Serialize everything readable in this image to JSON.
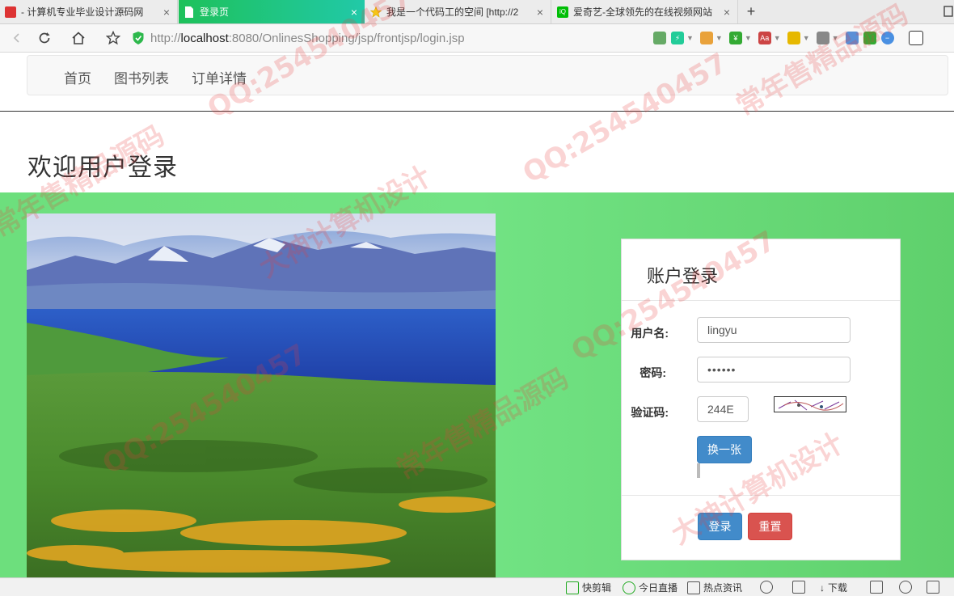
{
  "browser": {
    "tabs": [
      {
        "label": "- 计算机专业毕业设计源码网",
        "close": "×"
      },
      {
        "label": "登录页",
        "close": "×"
      },
      {
        "label": "我是一个代码工的空间 [http://2",
        "close": "×"
      },
      {
        "label": "爱奇艺-全球领先的在线视频网站",
        "close": "×"
      }
    ],
    "new_tab": "+",
    "url_prefix": "http://",
    "url_host": "localhost",
    "url_rest": ":8080/OnlinesShopping/jsp/frontjsp/login.jsp"
  },
  "nav": {
    "items": [
      "首页",
      "图书列表",
      "订单详情"
    ]
  },
  "page": {
    "heading": "欢迎用户登录"
  },
  "login": {
    "title": "账户登录",
    "username_label": "用户名:",
    "username_value": "lingyu",
    "password_label": "密码:",
    "password_value": "••••••",
    "captcha_label": "验证码:",
    "captcha_value": "244E",
    "refresh_label": "换一张",
    "submit_label": "登录",
    "reset_label": "重置"
  },
  "statusbar": {
    "items": [
      "快剪辑",
      "今日直播",
      "热点资讯",
      "下载"
    ]
  },
  "watermark": {
    "qq": "QQ:254540457",
    "text1": "大神计算机设计",
    "text2": "常年售精品源码"
  },
  "colors": {
    "accent_green": "#1ec15a",
    "panel_green": "#72e384",
    "primary_blue": "#428bca",
    "danger_red": "#d9534f"
  }
}
